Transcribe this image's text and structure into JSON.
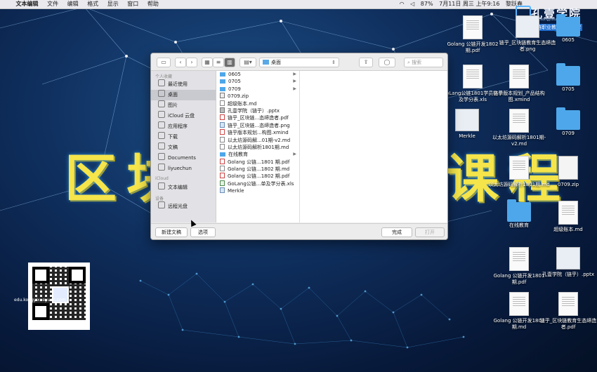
{
  "menubar": {
    "app": "文本编辑",
    "items": [
      "文件",
      "编辑",
      "格式",
      "显示",
      "窗口",
      "帮助"
    ],
    "battery": "87%",
    "clock": "7月11日 周三 上午9:16",
    "user": "黎跃春"
  },
  "brand": {
    "name": "孔壹学院",
    "url": "www.kongyixueyuan.com",
    "slogan": "国内区块链职业教育领先品牌"
  },
  "background": {
    "title_left": "区块",
    "title_right": "课程"
  },
  "desktop_icons": [
    {
      "label": "Golang 公链开发1802 期.pdf",
      "kind": "pdf"
    },
    {
      "label": "链乎_区块链教育生态缔造者.png",
      "kind": "png"
    },
    {
      "label": "0605",
      "kind": "folder"
    },
    {
      "label": "GoLang公链1801学员名单及学分表.xls",
      "kind": "xls"
    },
    {
      "label": "链乎版本规划_产品结构图.xmind",
      "kind": "xmind"
    },
    {
      "label": "0705",
      "kind": "folder"
    },
    {
      "label": "Merkle",
      "kind": "folder"
    },
    {
      "label": "以太坊源码解析1801期-v2.md",
      "kind": "md"
    },
    {
      "label": "0709",
      "kind": "folder"
    },
    {
      "label": "以太坊源码解析1801期.md",
      "kind": "md"
    },
    {
      "label": "0709.zip",
      "kind": "zip"
    },
    {
      "label": "在线教育",
      "kind": "folder"
    },
    {
      "label": "超级账本.md",
      "kind": "md"
    },
    {
      "label": "Golang 公链开发1801 期.pdf",
      "kind": "pdf"
    },
    {
      "label": "孔壹学院（链乎）.pptx",
      "kind": "pptx"
    },
    {
      "label": "Golang 公链开发1802 期.md",
      "kind": "md"
    },
    {
      "label": "链乎_区块链教育生态缔造者.pdf",
      "kind": "pdf"
    }
  ],
  "qr": {
    "url_text": "edu.kongyixueyuan.com"
  },
  "dialog": {
    "path": "桌面",
    "search_placeholder": "搜索",
    "sidebar": {
      "sections": [
        {
          "header": "个人收藏",
          "items": [
            {
              "label": "最近使用",
              "icon": "clock-icon"
            },
            {
              "label": "桌面",
              "icon": "desktop-icon",
              "selected": true
            },
            {
              "label": "图片",
              "icon": "pictures-icon"
            },
            {
              "label": "iCloud 云盘",
              "icon": "cloud-icon"
            },
            {
              "label": "应用程序",
              "icon": "applications-icon"
            },
            {
              "label": "下载",
              "icon": "download-icon"
            },
            {
              "label": "文稿",
              "icon": "documents-icon"
            },
            {
              "label": "Documents",
              "icon": "folder-icon"
            },
            {
              "label": "liyuechun",
              "icon": "home-icon"
            }
          ]
        },
        {
          "header": "iCloud",
          "items": [
            {
              "label": "文本编辑",
              "icon": "textedit-icon"
            }
          ]
        },
        {
          "header": "设备",
          "items": [
            {
              "label": "远程光盘",
              "icon": "disc-icon"
            }
          ]
        }
      ]
    },
    "files": [
      {
        "name": "0605",
        "type": "folder",
        "has_children": true
      },
      {
        "name": "0705",
        "type": "folder",
        "has_children": true
      },
      {
        "name": "0709",
        "type": "folder",
        "has_children": true
      },
      {
        "name": "0709.zip",
        "type": "zip"
      },
      {
        "name": "超级账本.md",
        "type": "md"
      },
      {
        "name": "孔壹学院（链乎）.pptx",
        "type": "pptx"
      },
      {
        "name": "链乎_区块链...态缔造者.pdf",
        "type": "pdf"
      },
      {
        "name": "链乎_区块链...态缔造者.png",
        "type": "png"
      },
      {
        "name": "链乎版本规划...构图.xmind",
        "type": "xmind"
      },
      {
        "name": "以太坊源码解...01期-v2.md",
        "type": "md"
      },
      {
        "name": "以太坊源码解析1801期.md",
        "type": "md"
      },
      {
        "name": "在线教育",
        "type": "folder",
        "has_children": true
      },
      {
        "name": "Golang 公链...1801 期.pdf",
        "type": "pdf"
      },
      {
        "name": "Golang 公链...1802 期.md",
        "type": "md"
      },
      {
        "name": "Golang 公链...1802 期.pdf",
        "type": "pdf"
      },
      {
        "name": "GoLang公链...单及学分表.xls",
        "type": "xls"
      },
      {
        "name": "Merkle",
        "type": "folder"
      }
    ],
    "buttons": {
      "new_document": "新建文稿",
      "options": "选项",
      "done": "完成",
      "open": "打开"
    }
  }
}
